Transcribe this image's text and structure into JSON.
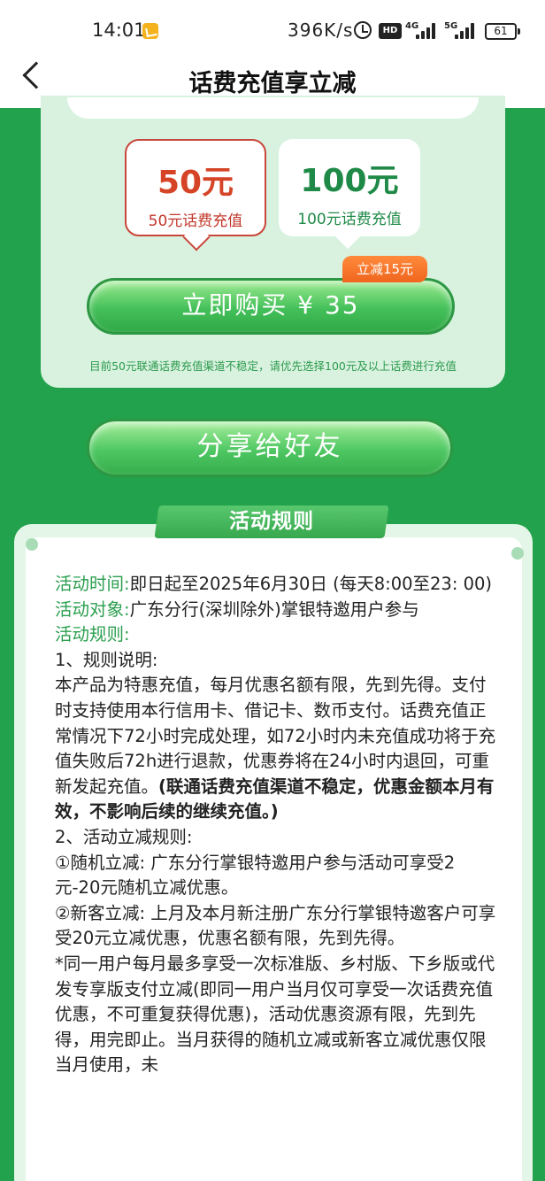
{
  "status_bar": {
    "time": "14:01",
    "net_speed": "396K/s",
    "hd_label": "HD",
    "net1": "4G",
    "net2": "5G",
    "battery": "61"
  },
  "nav": {
    "title": "话费充值享立减"
  },
  "options": [
    {
      "amount": "50元",
      "label": "50元话费充值",
      "selected": true
    },
    {
      "amount": "100元",
      "label": "100元话费充值",
      "selected": false
    }
  ],
  "discount_badge": "立减15元",
  "buy_button": "立即购买 ¥ 35",
  "notice": "目前50元联通话费充值渠道不稳定，请优先选择100元及以上话费进行充值",
  "share_button": "分享给好友",
  "rules": {
    "header": "活动规则",
    "time_label": "活动时间:",
    "time_value": "即日起至2025年6月30日 (每天8:00至23: 00)",
    "target_label": "活动对象:",
    "target_value": "广东分行(深圳除外)掌银特邀用户参与",
    "rules_label": "活动规则:",
    "s1_title": "1、规则说明:",
    "s1_text": "本产品为特惠充值，每月优惠名额有限，先到先得。支付时支持使用本行信用卡、借记卡、数币支付。话费充值正常情况下72小时完成处理，如72小时内未充值成功将于充值失败后72h进行退款，优惠券将在24小时内退回，可重新发起充值。",
    "s1_bold": "(联通话费充值渠道不稳定，优惠金额本月有效，不影响后续的继续充值。)",
    "s2_title": "2、活动立减规则:",
    "s2_item1": "①随机立减: 广东分行掌银特邀用户参与活动可享受2元-20元随机立减优惠。",
    "s2_item2": "②新客立减: 上月及本月新注册广东分行掌银特邀客户可享受20元立减优惠，优惠名额有限，先到先得。",
    "s2_note": "*同一用户每月最多享受一次标准版、乡村版、下乡版或代发专享版支付立减(即同一用户当月仅可享受一次话费充值优惠，不可重复获得优惠)，活动优惠资源有限，先到先得，用完即止。当月获得的随机立减或新客立减优惠仅限当月使用，未"
  },
  "colors": {
    "page_bg": "#22a24c",
    "accent_green": "#2b9f4e",
    "selected_red": "#d64427",
    "badge_orange": "#f0661f"
  }
}
